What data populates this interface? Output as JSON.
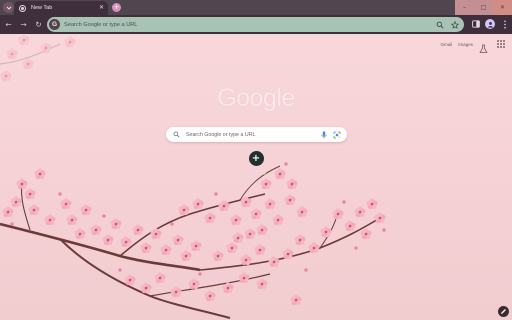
{
  "tab": {
    "title": "New Tab",
    "close_glyph": "✕",
    "favicon": "chrome-new-tab-icon"
  },
  "new_tab_glyph": "+",
  "window_controls": {
    "minimize": "–",
    "maximize": "□",
    "close": "✕"
  },
  "toolbar": {
    "back_glyph": "←",
    "forward_glyph": "→",
    "reload_glyph": "↻",
    "omnibox_badge": "G",
    "omnibox_placeholder": "Search Google or type a URL"
  },
  "ntp": {
    "links": [
      "Gmail",
      "Images"
    ],
    "logo": "Google",
    "search_placeholder": "Search Google or type a URL",
    "shortcut_glyph": "+",
    "shortcut_label": "Add shortcut"
  },
  "colors": {
    "tab_strip": "#51464f",
    "toolbar": "#3f2e3b",
    "omnibox": "#a7c3b6",
    "background": "#f7d5d8",
    "blossom": "#f2a9b8",
    "branch": "#6b3b3b"
  }
}
